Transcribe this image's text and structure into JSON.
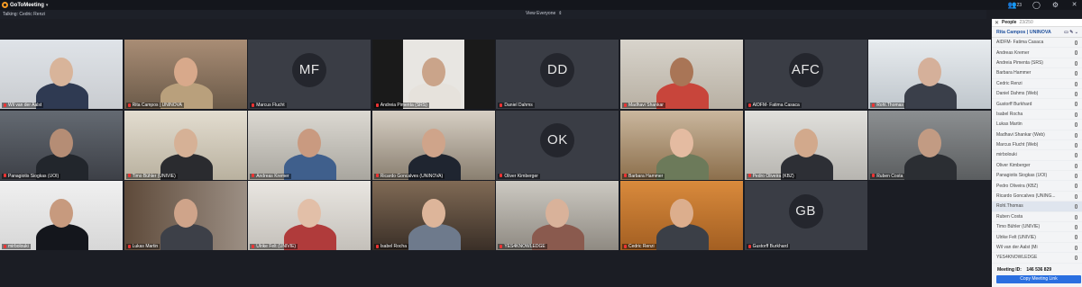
{
  "app": {
    "name": "GoToMeeting"
  },
  "topbar": {
    "attendee_count": "23"
  },
  "subbar": {
    "talking": "Talking: Cedric Renzi",
    "view_mode": "View Everyone"
  },
  "tiles": [
    {
      "name": "Wil van der Aalst",
      "initials": ""
    },
    {
      "name": "Rita Campos | UNINOVA",
      "initials": ""
    },
    {
      "name": "Marcus Flucht",
      "initials": "MF"
    },
    {
      "name": "Andreia Pimenta (SRS)",
      "initials": ""
    },
    {
      "name": "Daniel Dahms",
      "initials": "DD"
    },
    {
      "name": "Madhavi Shankar",
      "initials": ""
    },
    {
      "name": "AIDFM- Fatima Casaca",
      "initials": "AFC"
    },
    {
      "name": "Rohl.Thomas",
      "initials": ""
    },
    {
      "name": "Panagiotis Siogkas (UOI)",
      "initials": ""
    },
    {
      "name": "Timo Bühler (UNIVIE)",
      "initials": ""
    },
    {
      "name": "Andreas Kremer",
      "initials": ""
    },
    {
      "name": "Ricardo Goncalves (UNINOVA)",
      "initials": ""
    },
    {
      "name": "Oliver Kimberger",
      "initials": "OK"
    },
    {
      "name": "Barbara Hammer",
      "initials": ""
    },
    {
      "name": "Pedro Oliveira (KBZ)",
      "initials": ""
    },
    {
      "name": "Ruben Costa",
      "initials": ""
    },
    {
      "name": "mirbolouki",
      "initials": ""
    },
    {
      "name": "Lukas Martin",
      "initials": ""
    },
    {
      "name": "Ulrike Felt (UNIVIE)",
      "initials": ""
    },
    {
      "name": "Isabel Rocha",
      "initials": ""
    },
    {
      "name": "YES4KNOWLEDGE",
      "initials": ""
    },
    {
      "name": "Cedric Renzi",
      "initials": ""
    },
    {
      "name": "Gustorff Burkhard",
      "initials": "GB"
    }
  ],
  "panel": {
    "title": "People",
    "count": "23/250",
    "me": "Rita Campos | UNINOVA",
    "participants": [
      "AIDFM- Fatima Casaca",
      "Andreas Kremer",
      "Andreia Pimenta (SRS)",
      "Barbara Hammer",
      "Cedric Renzi",
      "Daniel Dahms (Web)",
      "Gustorff Burkhard",
      "Isabel Rocha",
      "Lukas Martin",
      "Madhavi Shankar (Web)",
      "Marcus Flucht (Web)",
      "mirbolouki",
      "Oliver Kimberger",
      "Panagiotis Siogkas (UOI)",
      "Pedro Oliveira (KBZ)",
      "Ricardo Goncalves (UNING...",
      "Rohl.Thomas",
      "Ruben Costa",
      "Timo Bühler (UNIVIE)",
      "Ulrike Felt (UNIVIE)",
      "Wil van der Aalst (Mi",
      "YES4KNOWLEDGE"
    ],
    "meeting_id_label": "Meeting ID:",
    "meeting_id": "146 536 829",
    "copy_link_label": "Copy Meeting Link"
  },
  "colors": {
    "accent": "#2a6fe0",
    "brand": "#f59a23",
    "background": "#1b1d24"
  }
}
